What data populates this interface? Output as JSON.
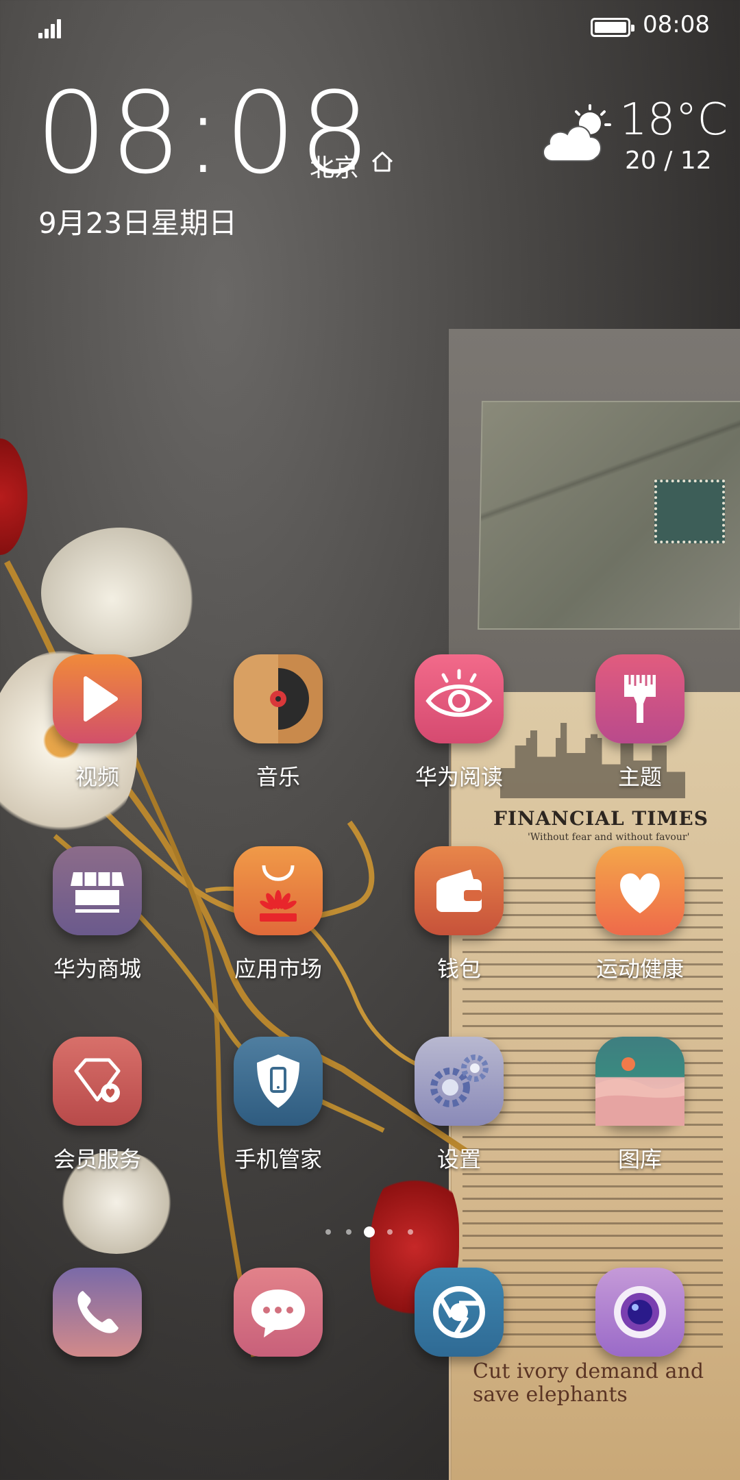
{
  "status_bar": {
    "time": "08:08",
    "icons": [
      "signal-icon",
      "battery-icon"
    ]
  },
  "clock_widget": {
    "time": "08:08",
    "city": "北京",
    "date": "9月23日星期日",
    "temperature": "18°C",
    "range": "20 / 12",
    "weather_icon": "partly-cloudy-icon"
  },
  "apps": [
    {
      "label": "视频",
      "icon": "video-play-icon"
    },
    {
      "label": "音乐",
      "icon": "music-disc-icon"
    },
    {
      "label": "华为阅读",
      "icon": "eye-reading-icon"
    },
    {
      "label": "主题",
      "icon": "paintbrush-icon"
    },
    {
      "label": "华为商城",
      "icon": "store-icon"
    },
    {
      "label": "应用市场",
      "icon": "shopping-bag-icon"
    },
    {
      "label": "钱包",
      "icon": "wallet-icon"
    },
    {
      "label": "运动健康",
      "icon": "heart-icon"
    },
    {
      "label": "会员服务",
      "icon": "diamond-icon"
    },
    {
      "label": "手机管家",
      "icon": "shield-phone-icon"
    },
    {
      "label": "设置",
      "icon": "gear-icon"
    },
    {
      "label": "图库",
      "icon": "landscape-icon"
    }
  ],
  "page_indicator": {
    "count": 5,
    "active": 2
  },
  "dock": [
    {
      "icon": "phone-icon"
    },
    {
      "icon": "message-icon"
    },
    {
      "icon": "browser-icon"
    },
    {
      "icon": "camera-icon"
    }
  ],
  "wallpaper": {
    "newspaper_title": "FINANCIAL TIMES",
    "newspaper_tagline": "'Without fear and without favour'",
    "newspaper_bottom_headline": "Cut ivory demand and save elephants"
  }
}
